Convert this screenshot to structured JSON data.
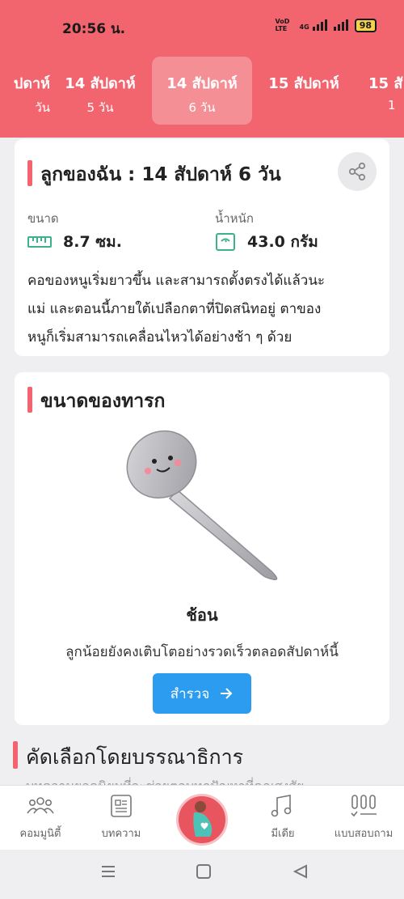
{
  "status": {
    "time": "20:56 น.",
    "net": "VoD LTE",
    "net_type": "4G",
    "battery": "98"
  },
  "weeks": [
    {
      "week": "ปดาห์",
      "days": "วัน"
    },
    {
      "week": "14 สัปดาห์",
      "days": "5 วัน"
    },
    {
      "week": "14 สัปดาห์",
      "days": "6 วัน"
    },
    {
      "week": "15 สัปดาห์",
      "days": ""
    },
    {
      "week": "15 สั",
      "days": "1"
    }
  ],
  "baby_card": {
    "title": "ลูกของฉัน : 14 สัปดาห์ 6  วัน",
    "size_label": "ขนาด",
    "size_value": "8.7 ซม.",
    "weight_label": "น้ำหนัก",
    "weight_value": "43.0 กรัม",
    "desc_lines": [
      "คอของหนูเริ่มยาวขึ้น และสามารถตั้งตรงได้แล้วนะ",
      "แม่ และตอนนี้ภายใต้เปลือกตาที่ปิดสนิทอยู่ ตาของ",
      "หนูก็เริ่มสามารถเคลื่อนไหวได้อย่างช้า ๆ ด้วย"
    ]
  },
  "size_card": {
    "title": "ขนาดของทารก",
    "object": "ช้อน",
    "object_desc": "ลูกน้อยยังคงเติบโตอย่างรวดเร็วตลอดสัปดาห์นี้",
    "button": "สำรวจ"
  },
  "editor": {
    "title": "คัดเลือกโดยบรรณาธิการ",
    "peek": "บทความยอดนิยมที่จะช่วยตอบทุกปัญหาที่คุณสงสัย"
  },
  "tabs": {
    "community": "คอมมูนิตี้",
    "articles": "บทความ",
    "media": "มีเดีย",
    "quiz": "แบบสอบถาม"
  },
  "colors": {
    "primary": "#f2646e",
    "button": "#2c9cf0"
  }
}
